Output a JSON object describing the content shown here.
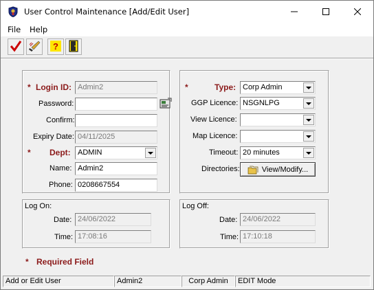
{
  "window": {
    "title": "User Control Maintenance [Add/Edit User]",
    "minimize": "—",
    "maximize": "☐",
    "close": "✕"
  },
  "menu": {
    "items": [
      "File",
      "Help"
    ]
  },
  "toolbar": {
    "buttons": [
      "checkmark-icon",
      "edit-brush-icon",
      "help-question-icon",
      "exit-door-icon"
    ]
  },
  "user": {
    "login_id_label": "Login ID:",
    "login_id": "Admin2",
    "password_label": "Password:",
    "password": "",
    "confirm_label": "Confirm:",
    "confirm": "",
    "expiry_label": "Expiry Date:",
    "expiry": "04/11/2025",
    "dept_label": "Dept:",
    "dept": "ADMIN",
    "name_label": "Name:",
    "name": "Admin2",
    "phone_label": "Phone:",
    "phone": "0208667554"
  },
  "access": {
    "type_label": "Type:",
    "type": "Corp Admin",
    "ggp_label": "GGP Licence:",
    "ggp": "NSGNLPG",
    "view_label": "View Licence:",
    "view": "",
    "map_label": "Map Licence:",
    "map": "",
    "timeout_label": "Timeout:",
    "timeout": "20 minutes",
    "directories_label": "Directories:",
    "view_modify": "View/Modify..."
  },
  "logon": {
    "title": "Log On:",
    "date_label": "Date:",
    "date": "24/06/2022",
    "time_label": "Time:",
    "time": "17:08:16"
  },
  "logoff": {
    "title": "Log Off:",
    "date_label": "Date:",
    "date": "24/06/2022",
    "time_label": "Time:",
    "time": "17:10:18"
  },
  "required_note": "Required Field",
  "required_star": "*",
  "status": [
    "Add or Edit User",
    "Admin2",
    "Corp Admin",
    "EDIT Mode"
  ],
  "colors": {
    "required": "#8b1a1a",
    "checkmark": "#cc0000"
  }
}
